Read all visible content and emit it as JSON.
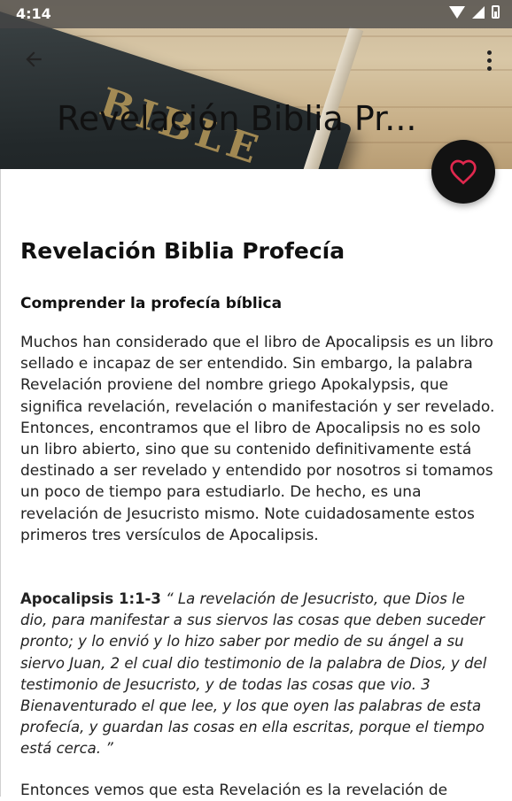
{
  "status_bar": {
    "time": "4:14"
  },
  "app_bar": {
    "back_icon": "arrow-back-icon",
    "title": "Revelación Biblia Pr...",
    "menu_icon": "more-vert-icon"
  },
  "header_image": {
    "book_text": "BIBLE"
  },
  "fab": {
    "icon": "heart-outline-icon",
    "icon_color": "#e0284e"
  },
  "article": {
    "title": "Revelación Biblia Profecía",
    "subtitle": "Comprender la profecía bíblica",
    "paragraph1": "Muchos han considerado que el libro de Apocalipsis es un libro sellado e incapaz de ser entendido. Sin embargo, la palabra Revelación proviene del nombre griego Apokalypsis, que significa revelación, revelación o manifestación y ser revelado. Entonces, encontramos que el libro de Apocalipsis no es solo un libro abierto, sino que su contenido definitivamente está destinado a ser revelado y entendido por nosotros si tomamos un poco de tiempo para estudiarlo. De hecho, es una revelación de Jesucristo mismo. Note cuidadosamente estos primeros tres versículos de Apocalipsis.",
    "verse_ref": "Apocalipsis 1:1-3",
    "verse_text": " “ La revelación de Jesucristo, que Dios le dio, para manifestar a sus siervos las cosas que deben suceder pronto; y lo envió y lo hizo saber por medio de su ángel a su siervo Juan, 2 el cual dio testimonio de la palabra de Dios, y del testimonio de Jesucristo, y de todas las cosas que vio. 3 Bienaventurado el que lee, y los que oyen las palabras de esta profecía, y guardan las cosas en ella escritas, porque el tiempo está cerca. ”",
    "paragraph2_partial": "Entonces vemos que esta Revelación es la revelación de"
  }
}
